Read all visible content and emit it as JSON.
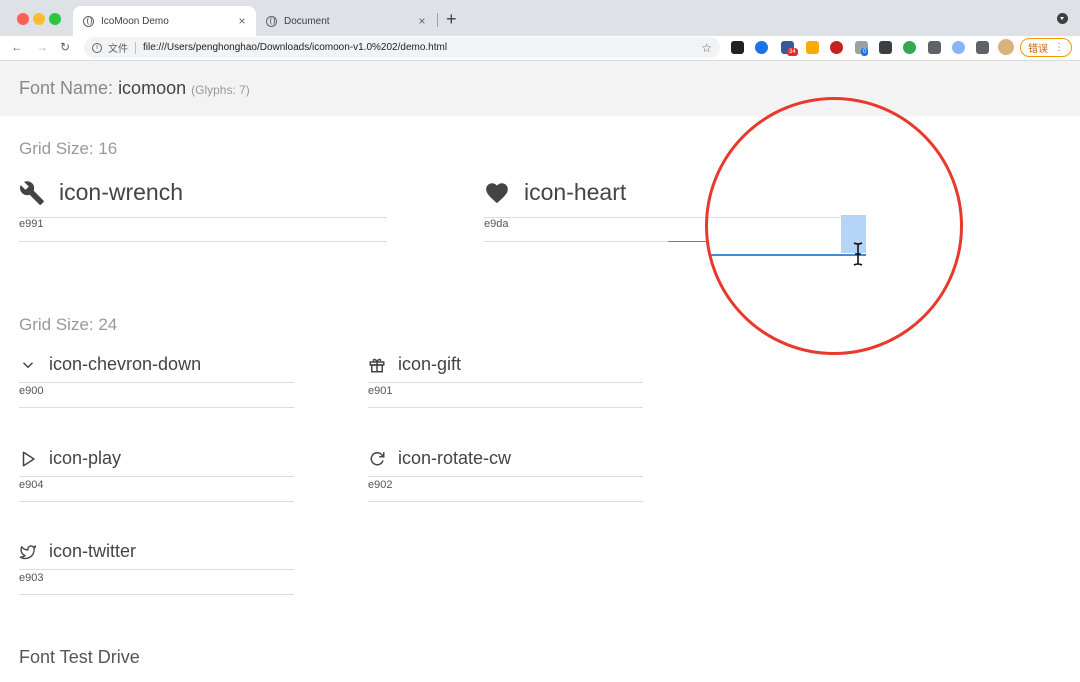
{
  "browser": {
    "tabs": [
      {
        "title": "IcoMoon Demo",
        "close": "×"
      },
      {
        "title": "Document",
        "close": "×"
      }
    ],
    "new_tab": "+",
    "nav": {
      "back": "←",
      "forward": "→",
      "reload": "↻"
    },
    "address": {
      "scheme_label": "文件",
      "url": "file:///Users/penghonghao/Downloads/icomoon-v1.0%202/demo.html",
      "star": "☆"
    },
    "error_button": {
      "label": "错误",
      "more": "⋮"
    },
    "extension_badges": {
      "mail": "34",
      "sync": "0"
    }
  },
  "page": {
    "font_label": "Font Name:",
    "font_name": "icomoon",
    "glyph_count": "(Glyphs: 7)",
    "grid16": {
      "heading": "Grid Size: 16",
      "glyphs": [
        {
          "icon": "wrench-icon",
          "name": "icon-wrench",
          "code": "e991"
        },
        {
          "icon": "heart-icon",
          "name": "icon-heart",
          "code": "e9da"
        }
      ]
    },
    "grid24": {
      "heading": "Grid Size: 24",
      "glyphs": [
        {
          "icon": "chevron-down-icon",
          "name": "icon-chevron-down",
          "code": "e900"
        },
        {
          "icon": "gift-icon",
          "name": "icon-gift",
          "code": "e901"
        },
        {
          "icon": "play-icon",
          "name": "icon-play",
          "code": "e904"
        },
        {
          "icon": "rotate-cw-icon",
          "name": "icon-rotate-cw",
          "code": "e902"
        },
        {
          "icon": "twitter-icon",
          "name": "icon-twitter",
          "code": "e903"
        }
      ]
    },
    "test_drive_heading": "Font Test Drive"
  },
  "colors": {
    "callout_circle": "#e8392e",
    "selection_highlight": "#b6d4f7",
    "focus_underline": "#3d8ed4"
  }
}
